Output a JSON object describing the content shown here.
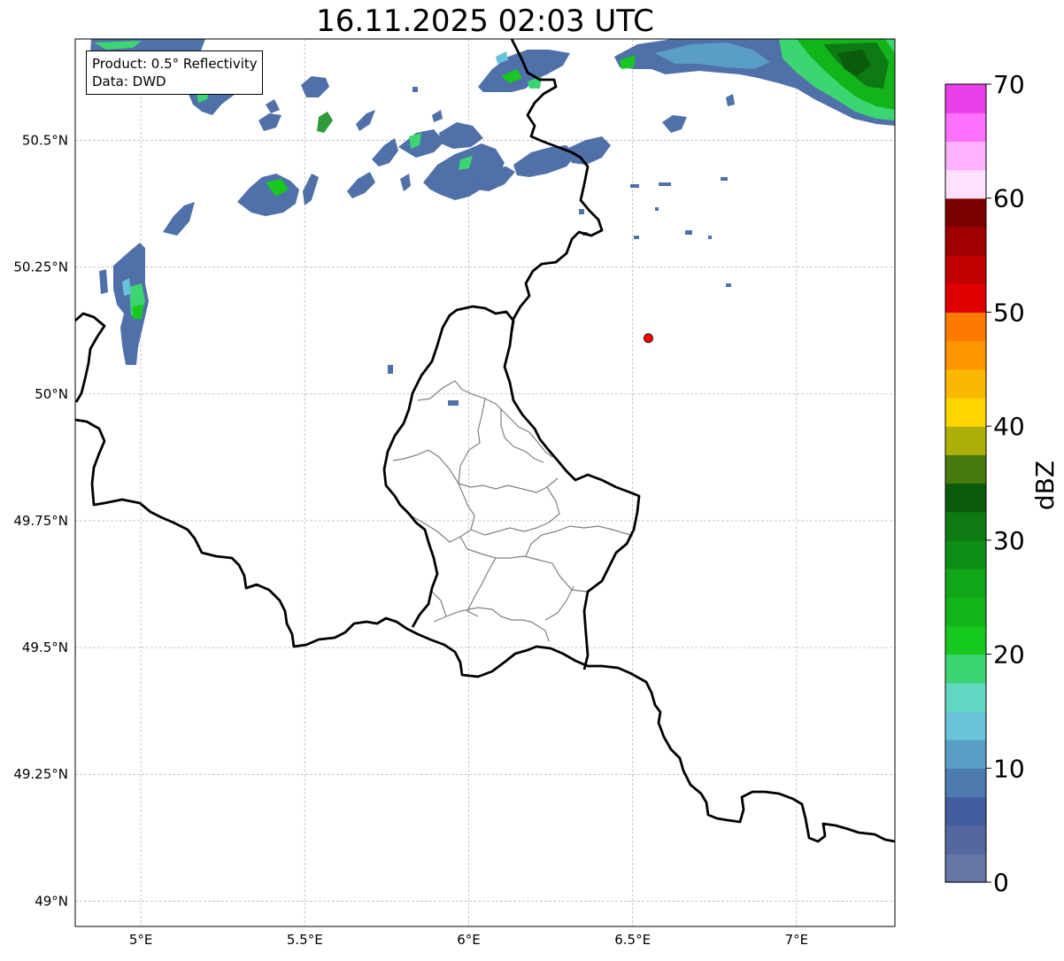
{
  "title": "16.11.2025 02:03 UTC",
  "info_box": {
    "product": "Product: 0.5° Reflectivity",
    "source": "Data: DWD"
  },
  "axes": {
    "lon_ticks": [
      "5°E",
      "5.5°E",
      "6°E",
      "6.5°E",
      "7°E"
    ],
    "lat_ticks": [
      "50.5°N",
      "50.25°N",
      "50°N",
      "49.75°N",
      "49.5°N",
      "49.25°N",
      "49°N"
    ],
    "lon_range": [
      4.8,
      7.3
    ],
    "lat_range": [
      48.95,
      50.7
    ],
    "grid": true
  },
  "colorbar": {
    "label": "dBZ",
    "ticks": [
      "0",
      "10",
      "20",
      "30",
      "40",
      "50",
      "60",
      "70"
    ],
    "range": [
      0,
      70
    ],
    "step": 2.5,
    "colors": [
      "#6475a6",
      "#54679e",
      "#435e9e",
      "#4d7bae",
      "#5a9ec6",
      "#68c3da",
      "#62d7c1",
      "#3dd472",
      "#17c81f",
      "#12b41a",
      "#11a518",
      "#0f8e16",
      "#0e7a14",
      "#0a5c0c",
      "#467a0c",
      "#adaf08",
      "#fdd600",
      "#fbb800",
      "#fc9500",
      "#fc7a00",
      "#e00000",
      "#c30000",
      "#a00000",
      "#7d0000",
      "#ffe0ff",
      "#ffb3ff",
      "#ff70ff",
      "#e840e8"
    ]
  },
  "radar_site": {
    "lon": 6.548,
    "lat": 50.11,
    "color": "#ff0000"
  }
}
